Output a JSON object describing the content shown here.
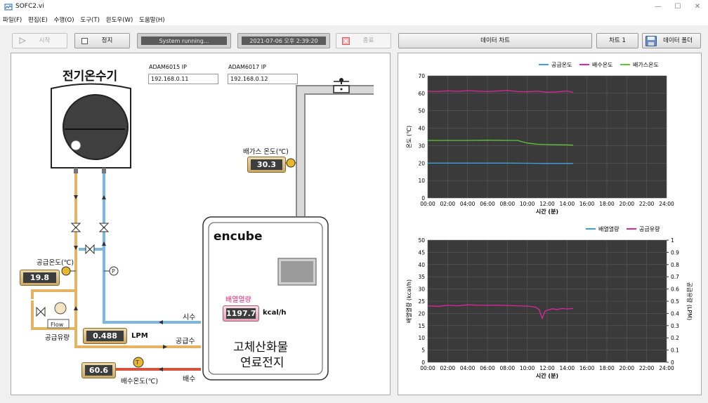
{
  "window": {
    "title": "SOFC2.vi",
    "controls": [
      "—",
      "☐",
      "✕"
    ]
  },
  "menu": [
    "파일(F)",
    "편집(E)",
    "수행(O)",
    "도구(T)",
    "윈도우(W)",
    "도움말(H)"
  ],
  "toolbar": {
    "start": "시작",
    "stop": "정지",
    "status": "System running...",
    "datetime": "2021-07-06 오후 2:39:20",
    "exit": "종료",
    "data_chart": "데이터 차트",
    "chart1": "차트 1",
    "data_folder": "데이터 폴더"
  },
  "diagram": {
    "heater_title": "전기온수기",
    "adam1_label": "ADAM6015 IP",
    "adam1_ip": "192.168.0.11",
    "adam2_label": "ADAM6017 IP",
    "adam2_ip": "192.168.0.12",
    "exhaust_temp_label": "배가스 온도(℃)",
    "exhaust_temp": "30.3",
    "supply_temp_label": "공급온도(℃)",
    "supply_temp": "19.8",
    "flow_tag": "Flow",
    "supply_flow_label": "공급유량",
    "supply_flow": "0.488",
    "supply_flow_unit": "LPM",
    "drain_temp": "60.6",
    "drain_temp_label": "배수온도(℃)",
    "t_tag": "T",
    "p_tag": "P",
    "encube": "encube",
    "heat_label": "배열열량",
    "heat_value": "1197.7",
    "heat_unit": "kcal/h",
    "fuel_cell_line1": "고체산화물",
    "fuel_cell_line2": "연료전지",
    "pipe_city": "시수",
    "pipe_supply": "공급수",
    "pipe_drain": "배수"
  },
  "chart_data": [
    {
      "type": "line",
      "ylabel": "온도 (℃)",
      "xlabel": "시간 (분)",
      "ylim": [
        0,
        70
      ],
      "yticks": [
        "0",
        "10",
        "20",
        "30",
        "40",
        "50",
        "60",
        "70"
      ],
      "xticks": [
        "00:00",
        "02:00",
        "04:00",
        "06:00",
        "08:00",
        "10:00",
        "12:00",
        "14:00",
        "16:00",
        "18:00",
        "20:00",
        "22:00",
        "24:00"
      ],
      "xlim_minutes": [
        0,
        24
      ],
      "legend_position": "top-right",
      "grid": true,
      "series": [
        {
          "name": "공급온도",
          "color": "#3aa3dc",
          "x": [
            0,
            2,
            4,
            6,
            8,
            10,
            12,
            14,
            14.6
          ],
          "y": [
            20.0,
            20.0,
            20.0,
            20.0,
            20.0,
            19.9,
            19.8,
            19.8,
            19.8
          ]
        },
        {
          "name": "배수온도",
          "color": "#e0269b",
          "x": [
            0,
            1,
            2,
            3,
            4,
            5,
            6,
            7,
            8,
            9,
            10,
            11,
            12,
            13,
            14,
            14.6
          ],
          "y": [
            61.2,
            61.0,
            61.4,
            61.1,
            61.5,
            61.2,
            61.0,
            61.3,
            61.6,
            61.0,
            60.9,
            61.2,
            60.6,
            60.8,
            61.3,
            60.6
          ]
        },
        {
          "name": "배가스온도",
          "color": "#5fc634",
          "x": [
            0,
            2,
            4,
            6,
            8,
            9,
            10,
            11,
            12,
            13,
            14,
            14.6
          ],
          "y": [
            33.0,
            33.0,
            33.0,
            33.1,
            33.0,
            33.0,
            31.5,
            30.8,
            30.6,
            30.5,
            30.4,
            30.3
          ]
        }
      ]
    },
    {
      "type": "line",
      "ylabel": "배열열량 (kcal/h)",
      "y2label": "공급유량 (LPM)",
      "xlabel": "시간 (분)",
      "ylim": [
        0,
        50
      ],
      "y2lim": [
        0,
        1
      ],
      "yticks": [
        "0",
        "5",
        "10",
        "15",
        "20",
        "25",
        "30",
        "35",
        "40",
        "45",
        "50"
      ],
      "y2ticks": [
        "0",
        "0.1",
        "0.2",
        "0.3",
        "0.4",
        "0.5",
        "0.6",
        "0.7",
        "0.8",
        "0.9",
        "1"
      ],
      "xticks": [
        "00:00",
        "02:00",
        "04:00",
        "06:00",
        "08:00",
        "10:00",
        "12:00",
        "14:00",
        "16:00",
        "18:00",
        "20:00",
        "22:00",
        "24:00"
      ],
      "xlim_minutes": [
        0,
        24
      ],
      "legend_position": "top-right",
      "grid": true,
      "series": [
        {
          "name": "배열열량",
          "color": "#3aa3dc",
          "x": [],
          "y": []
        },
        {
          "name": "공급유량",
          "color": "#e0269b",
          "axis": "y2",
          "x": [
            0,
            1,
            2,
            3,
            4,
            5,
            6,
            7,
            8,
            9,
            10,
            10.8,
            11.2,
            11.5,
            11.8,
            12.5,
            13,
            13.5,
            14,
            14.6
          ],
          "y": [
            0.462,
            0.458,
            0.466,
            0.462,
            0.47,
            0.468,
            0.466,
            0.468,
            0.465,
            0.462,
            0.46,
            0.452,
            0.432,
            0.36,
            0.42,
            0.438,
            0.432,
            0.44,
            0.436,
            0.44
          ]
        }
      ]
    }
  ]
}
